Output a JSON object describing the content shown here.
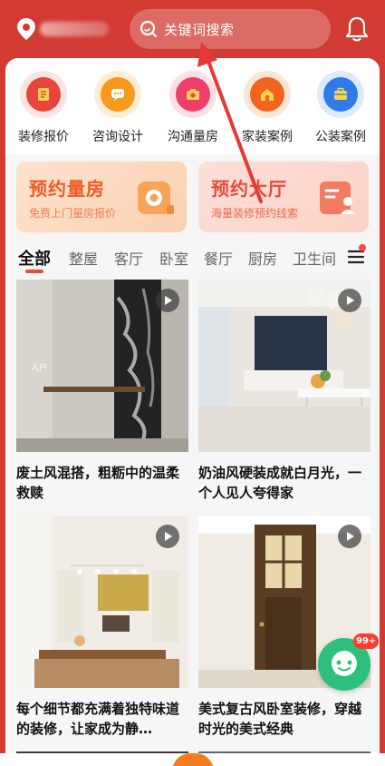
{
  "header": {
    "search_placeholder": "关键词搜索",
    "accent": "#d23a32"
  },
  "quick_actions": [
    {
      "label": "装修报价",
      "icon": "quote-icon",
      "color": "#e8453c"
    },
    {
      "label": "咨询设计",
      "icon": "chat-icon",
      "color": "#f59a1b"
    },
    {
      "label": "沟通量房",
      "icon": "camera-icon",
      "color": "#ee3e6a"
    },
    {
      "label": "家装案例",
      "icon": "home-icon",
      "color": "#f2641e"
    },
    {
      "label": "公装案例",
      "icon": "briefcase-icon",
      "color": "#2f7bea"
    }
  ],
  "banners": [
    {
      "title": "预约量房",
      "subtitle": "免费上门量房报价"
    },
    {
      "title": "预约大厅",
      "subtitle": "海量装修预约线索"
    }
  ],
  "tabs": [
    "全部",
    "整屋",
    "客厅",
    "卧室",
    "餐厅",
    "厨房",
    "卫生间"
  ],
  "active_tab": "全部",
  "feed": [
    {
      "title": "废土风混搭，粗粝中的温柔救赎",
      "image_text": "入户"
    },
    {
      "title": "奶油风硬装成就白月光，一个人见人夸得家"
    },
    {
      "title": "每个细节都充满着独特味道的装修，让家成为静…"
    },
    {
      "title": "美式复古风卧室装修，穿越时光的美式经典"
    }
  ],
  "chat_badge": "99+"
}
